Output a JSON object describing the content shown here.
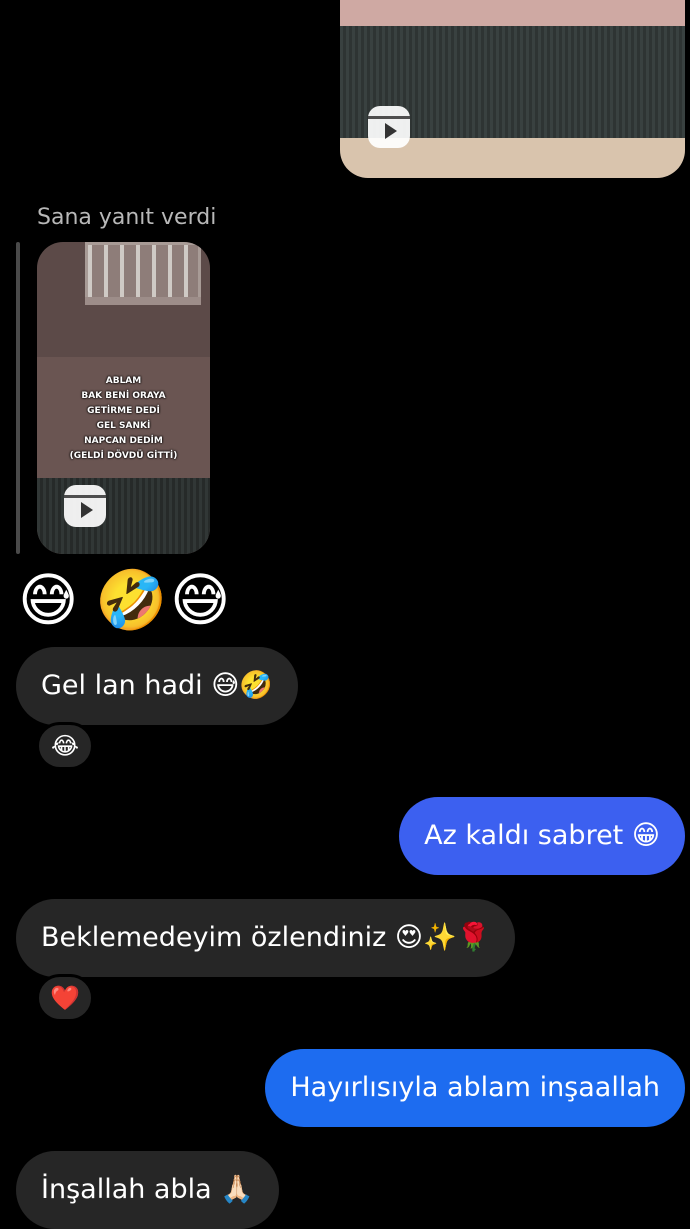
{
  "reply_header": "Sana yanıt verdi",
  "reel_caption": [
    "ABLAM",
    "BAK BENİ ORAYA",
    "GETİRME DEDİ",
    "GEL SANKİ",
    "NAPCAN DEDİM",
    "(GELDİ DÖVDÜ GİTTİ)"
  ],
  "emoji_row": [
    "😅",
    "🤣",
    "😅"
  ],
  "messages": [
    {
      "side": "in",
      "text": "Gel lan hadi 😅🤣",
      "reaction": "😂"
    },
    {
      "side": "out",
      "text": "Az kaldı sabret 😁"
    },
    {
      "side": "in",
      "text": "Beklemedeyim özlendiniz 😍✨🌹",
      "reaction": "❤️"
    },
    {
      "side": "out",
      "text": "Hayırlısıyla ablam inşaallah"
    },
    {
      "side": "in",
      "text": "İnşallah abla 🙏🏻"
    }
  ],
  "colors": {
    "outgoing_1": "#3c60f0",
    "outgoing_2": "#1d6cf0",
    "incoming": "#262626",
    "background": "#000000"
  },
  "icons": {
    "reel": "reels-play-icon"
  }
}
